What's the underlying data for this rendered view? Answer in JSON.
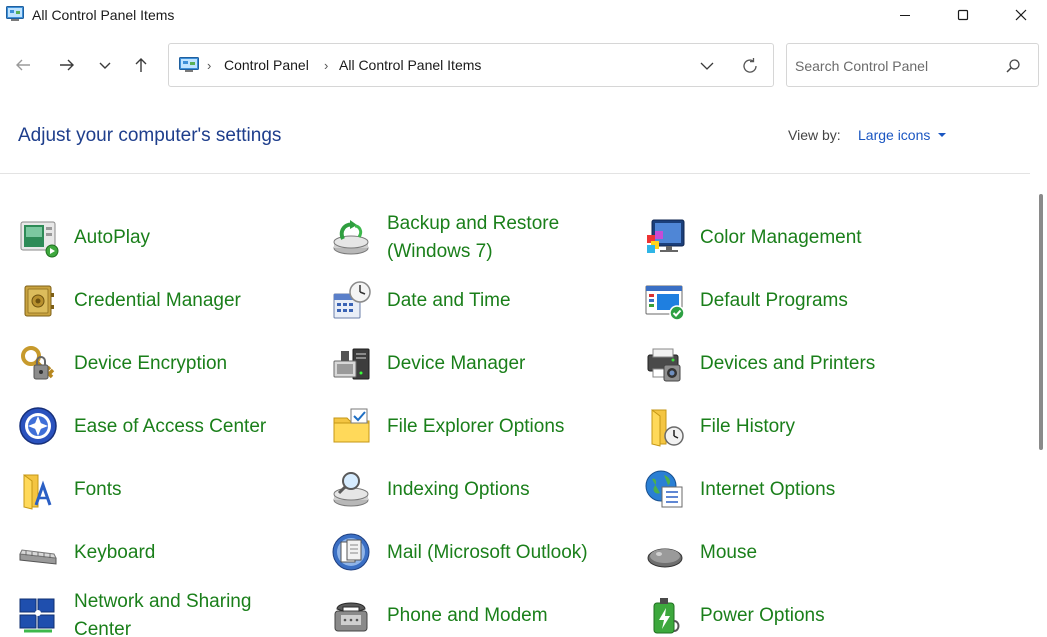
{
  "window": {
    "title": "All Control Panel Items"
  },
  "navigation": {
    "breadcrumbs": [
      "Control Panel",
      "All Control Panel Items"
    ]
  },
  "search": {
    "placeholder": "Search Control Panel",
    "value": ""
  },
  "header": {
    "title": "Adjust your computer's settings",
    "view_by_label": "View by:",
    "view_by_value": "Large icons"
  },
  "colors": {
    "title_blue": "#1e3e8c",
    "link_blue": "#1a56c2",
    "item_green": "#1a7f1a"
  },
  "items": [
    {
      "label": "AutoPlay",
      "icon": "autoplay-icon"
    },
    {
      "label": "Backup and Restore (Windows 7)",
      "icon": "backup-restore-icon"
    },
    {
      "label": "Color Management",
      "icon": "color-management-icon"
    },
    {
      "label": "Credential Manager",
      "icon": "credential-manager-icon"
    },
    {
      "label": "Date and Time",
      "icon": "date-time-icon"
    },
    {
      "label": "Default Programs",
      "icon": "default-programs-icon"
    },
    {
      "label": "Device Encryption",
      "icon": "device-encryption-icon"
    },
    {
      "label": "Device Manager",
      "icon": "device-manager-icon"
    },
    {
      "label": "Devices and Printers",
      "icon": "devices-printers-icon"
    },
    {
      "label": "Ease of Access Center",
      "icon": "ease-of-access-icon"
    },
    {
      "label": "File Explorer Options",
      "icon": "file-explorer-options-icon"
    },
    {
      "label": "File History",
      "icon": "file-history-icon"
    },
    {
      "label": "Fonts",
      "icon": "fonts-icon"
    },
    {
      "label": "Indexing Options",
      "icon": "indexing-options-icon"
    },
    {
      "label": "Internet Options",
      "icon": "internet-options-icon"
    },
    {
      "label": "Keyboard",
      "icon": "keyboard-icon"
    },
    {
      "label": "Mail (Microsoft Outlook)",
      "icon": "mail-icon"
    },
    {
      "label": "Mouse",
      "icon": "mouse-icon"
    },
    {
      "label": "Network and Sharing Center",
      "icon": "network-sharing-icon"
    },
    {
      "label": "Phone and Modem",
      "icon": "phone-modem-icon"
    },
    {
      "label": "Power Options",
      "icon": "power-options-icon"
    }
  ]
}
